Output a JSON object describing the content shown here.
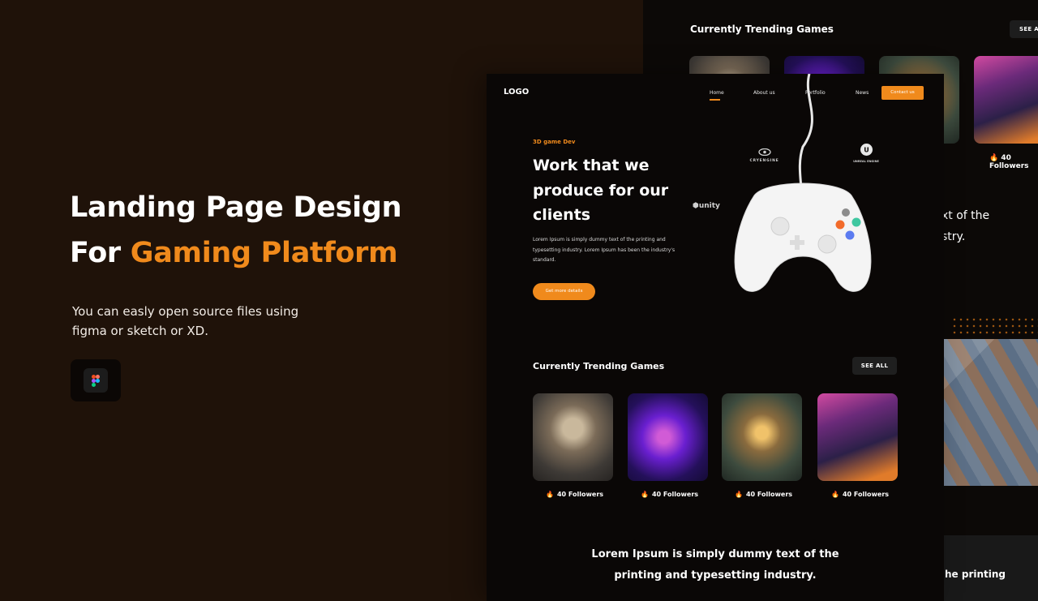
{
  "promo": {
    "headline_line1": "Landing Page Design",
    "headline_prefix": "For",
    "headline_accent": "Gaming Platform",
    "description_line1": "You can easly open source files using",
    "description_line2": "figma or sketch or XD."
  },
  "back_mockup": {
    "section_title": "Currently Trending Games",
    "see_all_label": "SEE A",
    "followers_label": "40 Followers",
    "partial_text_line1": "xt of the",
    "partial_text_line2": "stry.",
    "partial_bottom_text": "he printing"
  },
  "nav": {
    "logo": "LOGO",
    "items": [
      "Home",
      "About us",
      "Portfolio",
      "News"
    ],
    "contact_label": "Contact us"
  },
  "hero": {
    "tag": "3D game Dev",
    "title": "Work that we produce for our clients",
    "description": "Lorem Ipsum is simply dummy text of the printing and typesetting industry. Lorem Ipsum has been the industry's standard.",
    "cta_label": "Get more details",
    "brands": [
      "CRYENGINE",
      "UNREAL ENGINE",
      "unity"
    ]
  },
  "trending": {
    "title": "Currently Trending Games",
    "see_all_label": "SEE ALL",
    "games": [
      {
        "followers": "40 Followers"
      },
      {
        "followers": "40 Followers"
      },
      {
        "followers": "40 Followers"
      },
      {
        "followers": "40 Followers"
      }
    ]
  },
  "bottom": {
    "line1": "Lorem Ipsum is simply dummy text of the",
    "line2": "printing and typesetting industry."
  },
  "colors": {
    "accent": "#f08a1c",
    "page_bg": "#1f1209",
    "mockup_bg": "#0a0706"
  }
}
